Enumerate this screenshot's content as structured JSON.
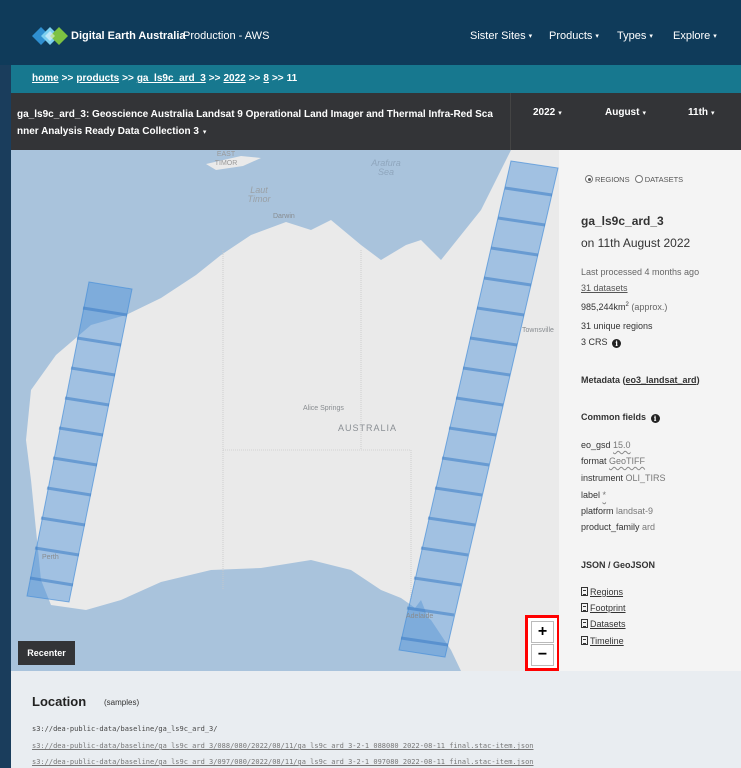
{
  "header": {
    "brand": "Digital Earth Australia",
    "environment": "Production - AWS",
    "nav": [
      {
        "label": "Sister Sites"
      },
      {
        "label": "Products"
      },
      {
        "label": "Types"
      },
      {
        "label": "Explore"
      }
    ],
    "caret_glyph": "▾"
  },
  "breadcrumb": {
    "home": "home",
    "products": "products",
    "product": "ga_ls9c_ard_3",
    "year": "2022",
    "month": "8",
    "day": "11",
    "separator": ">>"
  },
  "titlebar": {
    "product_code": "ga_ls9c_ard_3",
    "description": ": Geoscience Australia Landsat 9 Operational Land Imager and Thermal Infra-Red Scanner Analysis Ready Data Collection 3",
    "year": "2022",
    "month": "August",
    "day": "11th"
  },
  "map": {
    "labels": {
      "east_timor": "EAST\nTIMOR",
      "arafura_sea": "Arafura\nSea",
      "laut_timor": "Laut\nTimor",
      "darwin": "Darwin",
      "townsville": "Townsville",
      "alice_springs": "Alice Springs",
      "australia": "AUSTRALIA",
      "perth": "Perth",
      "adelaide": "Adelaide"
    },
    "recenter_label": "Recenter",
    "zoom_in": "+",
    "zoom_out": "−",
    "colors": {
      "ocean": "#a9c3dc",
      "land": "#eaeaea",
      "footprint": "#4a90d9"
    }
  },
  "panel": {
    "radio_regions": "REGIONS",
    "radio_datasets": "DATASETS",
    "selected": "regions",
    "title": "ga_ls9c_ard_3",
    "subtitle": "on 11th August 2022",
    "last_processed": "Last processed 4 months ago",
    "datasets_link": "31 datasets",
    "area_value": "985,244km",
    "area_exp": "2",
    "area_note": " (approx.)",
    "unique_regions": "31 unique regions",
    "crs": "3 CRS",
    "metadata_label": "Metadata (",
    "metadata_link": "eo3_landsat_ard",
    "metadata_close": ")",
    "common_fields_head": "Common fields",
    "fields": [
      {
        "key": "eo_gsd",
        "value": "15.0"
      },
      {
        "key": "format",
        "value": "GeoTIFF"
      },
      {
        "key": "instrument",
        "value": "OLI_TIRS"
      },
      {
        "key": "label",
        "value": "*"
      },
      {
        "key": "platform",
        "value": "landsat-9"
      },
      {
        "key": "product_family",
        "value": "ard"
      }
    ],
    "json_head": "JSON / GeoJSON",
    "json_links": [
      "Regions",
      "Footprint",
      "Datasets",
      "Timeline"
    ],
    "info_glyph": "i"
  },
  "location": {
    "title": "Location",
    "subtitle": "(samples)",
    "lines": [
      "s3://dea-public-data/baseline/ga_ls9c_ard_3/",
      "s3://dea-public-data/baseline/ga_ls9c_ard_3/088/080/2022/08/11/ga_ls9c_ard_3-2-1_088080_2022-08-11_final.stac-item.json",
      "s3://dea-public-data/baseline/ga_ls9c_ard_3/097/080/2022/08/11/ga_ls9c_ard_3-2-1_097080_2022-08-11_final.stac-item.json"
    ]
  }
}
